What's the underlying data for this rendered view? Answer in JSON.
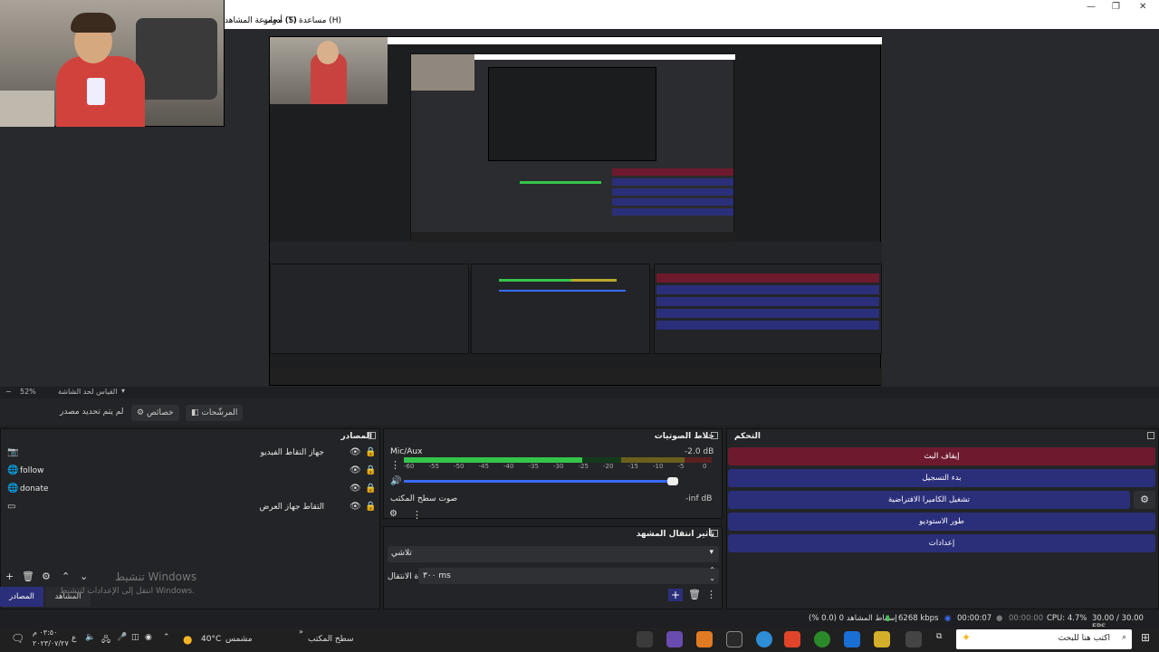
{
  "menu": {
    "items": [
      {
        "label": "مجموعة المشاهد (S)"
      },
      {
        "label": "أدوات (T)"
      },
      {
        "label": "مساعدة (H)"
      }
    ]
  },
  "zoom": {
    "value": "52%",
    "label": "القياس لحد الشاشة"
  },
  "context": {
    "no_source": "لم يتم تحديد مصدر",
    "properties": "خصائص",
    "filters": "المرشّحات"
  },
  "sources": {
    "title": "المصادر",
    "items": [
      {
        "label": "جهاز التقاط الفيديو",
        "icon": "camera-icon"
      },
      {
        "label": "follow",
        "icon": "browser-icon"
      },
      {
        "label": "donate",
        "icon": "browser-icon"
      },
      {
        "label": "التقاط جهاز العرض",
        "icon": "monitor-icon"
      }
    ],
    "tab_sources": "المصادر",
    "tab_scenes": "المشاهد"
  },
  "mixer": {
    "title": "خلاط الصوتيات",
    "channels": [
      {
        "name": "Mic/Aux",
        "db": "-2.0 dB",
        "level": 0.58
      },
      {
        "name": "صوت سطح المكتب",
        "db": "-inf dB",
        "level": 0
      }
    ],
    "ticks": [
      "-60",
      "-55",
      "-50",
      "-45",
      "-40",
      "-35",
      "-30",
      "-25",
      "-20",
      "-15",
      "-10",
      "-5",
      "0"
    ]
  },
  "transitions": {
    "title": "تأثير انتقال المشهد",
    "type": "تلاشي",
    "duration_label": "مدة الانتقال",
    "duration_value": "٣٠٠ ms"
  },
  "controls": {
    "title": "التحكم",
    "buttons": [
      {
        "label": "إيقاف البث",
        "color": "#6e1a2e"
      },
      {
        "label": "بدء التسجيل",
        "color": "#2b2f7a"
      },
      {
        "label": "تشغيل الكاميرا الافتراضية",
        "color": "#2b2f7a"
      },
      {
        "label": "طور الاستوديو",
        "color": "#2b2f7a"
      },
      {
        "label": "إعدادات",
        "color": "#2b2f7a"
      }
    ]
  },
  "watermark": {
    "line1": "تنشيط Windows",
    "line2": "انتقل إلى الإعدادات لتنشيط Windows."
  },
  "status": {
    "dropped": "إسقاط المشاهد 0 (0.0 %)",
    "bitrate": "6268 kbps",
    "stream_time": "00:00:07",
    "rec_time": "00:00:00",
    "cpu": "CPU: 4.7%",
    "fps": "30.00 / 30.00 FPS"
  },
  "taskbar": {
    "search": "اكتب هنا للبحث",
    "desktop": "سطح المكتب",
    "weather_temp": "40°C",
    "weather_desc": "مشمس",
    "time": "٠٣:٥٠ م",
    "date": "٢٠٢٣/٠٧/٢٧",
    "lang": "ع"
  }
}
